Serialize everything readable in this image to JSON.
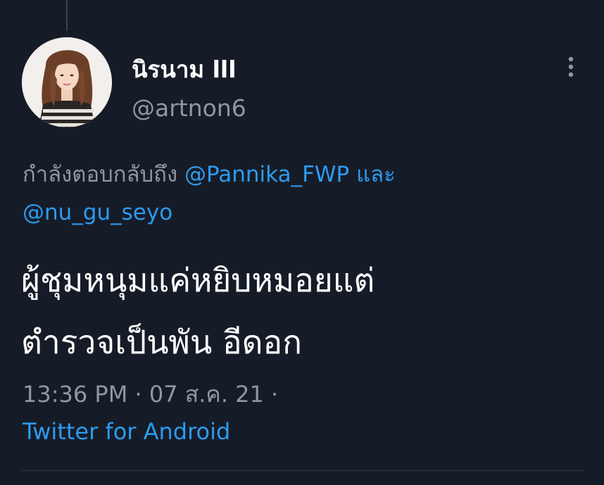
{
  "author": {
    "display_name": "นิรนาม lll",
    "handle": "@artnon6"
  },
  "reply_context": {
    "prefix": "กำลังตอบกลับถึง",
    "mention_1": "@Pannika_FWP",
    "joiner": "และ",
    "mention_2": "@nu_gu_seyo"
  },
  "tweet": {
    "line_1": "ผู้ชุมหนุมแค่หยิบหมอยแต่",
    "line_2": "ตำรวจเป็นพัน อีดอก"
  },
  "meta": {
    "time": "13:36 PM",
    "separator": "·",
    "date": "07 ส.ค. 21",
    "trailing_separator": "·",
    "source": "Twitter for Android"
  },
  "icons": {
    "more": "more-vertical-icon"
  },
  "colors": {
    "background": "#161c27",
    "link": "#2d9bf0",
    "muted": "#8b98a5",
    "text": "#ffffff"
  }
}
